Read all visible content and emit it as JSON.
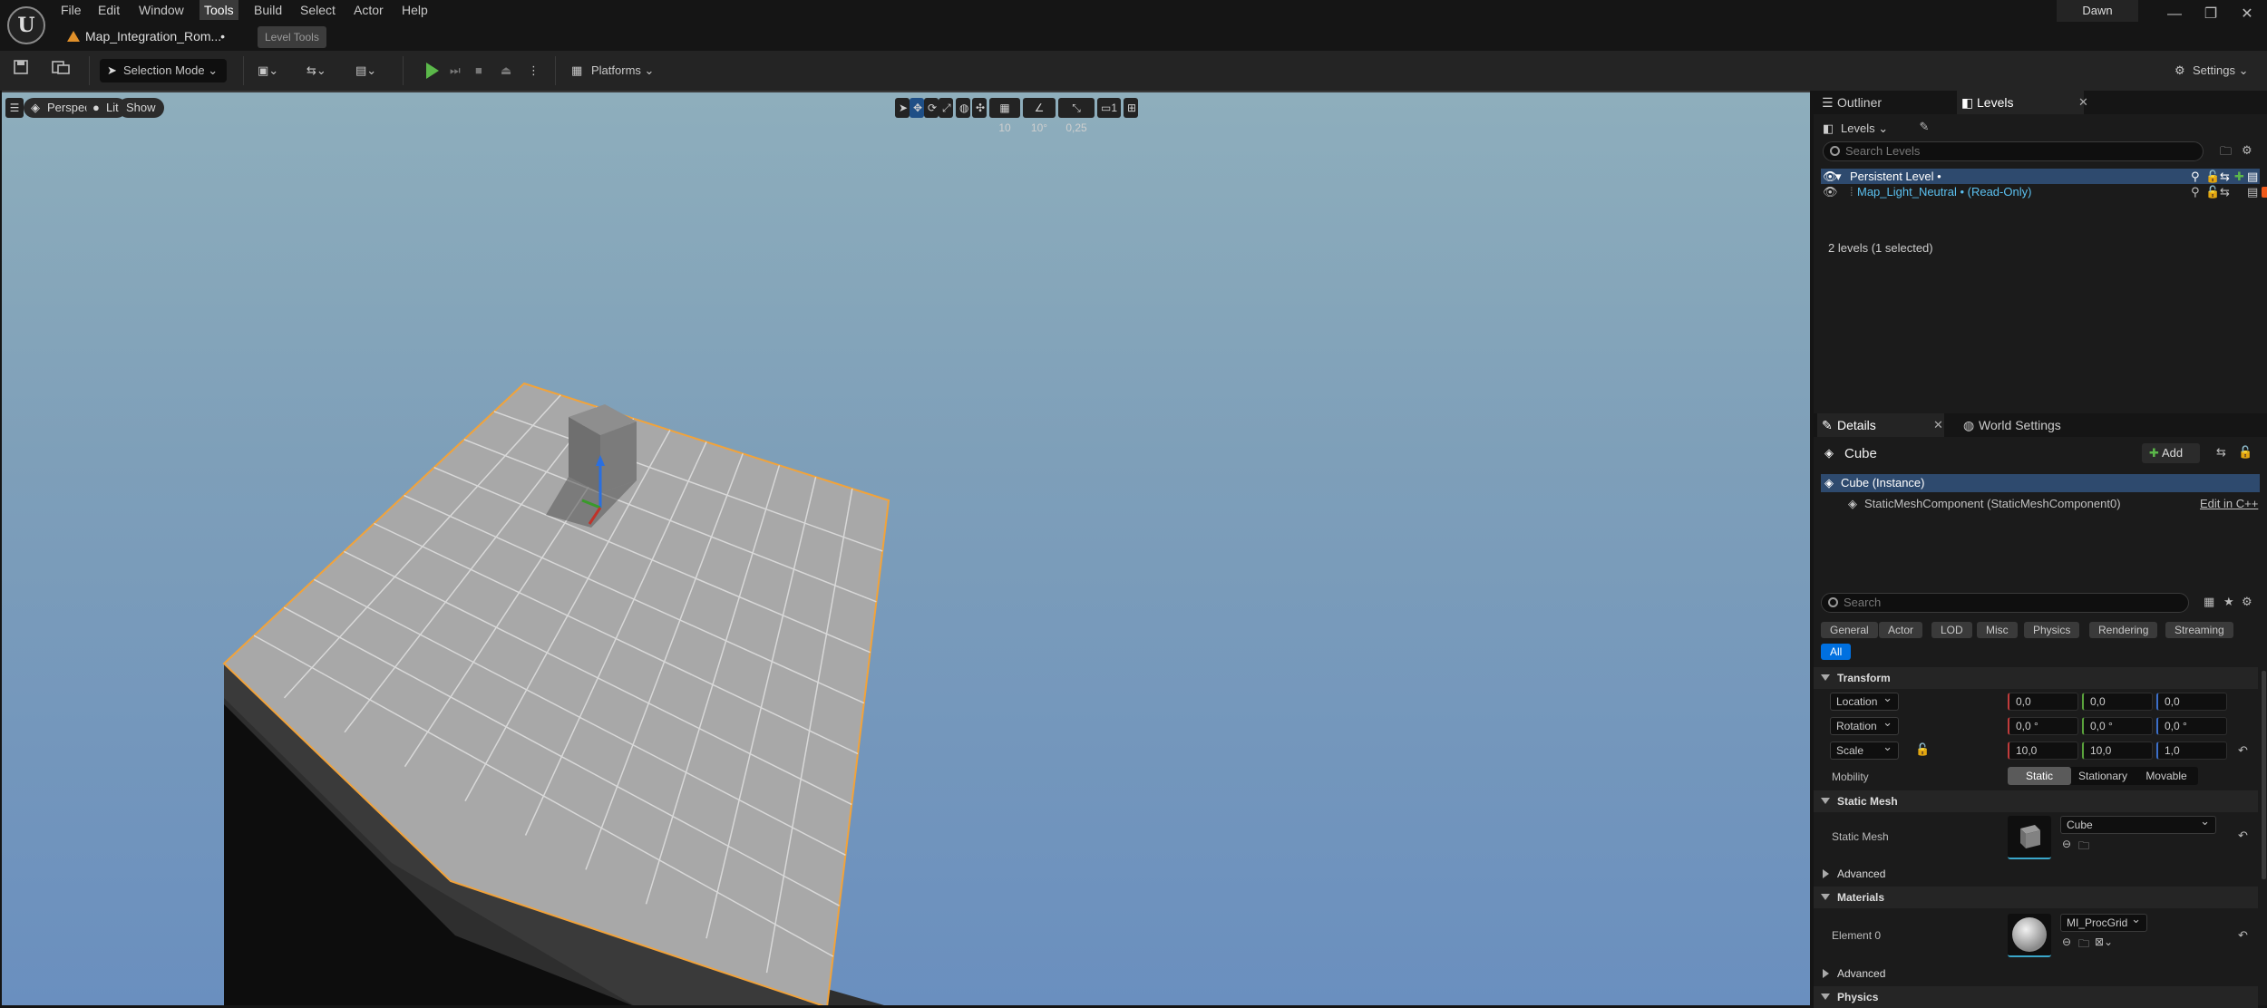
{
  "menu": [
    "File",
    "Edit",
    "Window",
    "Tools",
    "Build",
    "Select",
    "Actor",
    "Help"
  ],
  "menu_active": "Tools",
  "document_tab": {
    "title": "Map_Integration_Rom...",
    "modified_marker": "•"
  },
  "level_tools_label": "Level Tools",
  "user_name": "Dawn",
  "window_controls": {
    "minimize": "—",
    "maximize": "❐",
    "close": "✕"
  },
  "toolbar": {
    "selection_mode": "Selection Mode",
    "platforms": "Platforms",
    "settings": "Settings"
  },
  "viewport": {
    "perspective": "Perspective",
    "lit": "Lit",
    "show": "Show",
    "grid_snap": "10",
    "rotation_snap": "10°",
    "scale_snap": "0,25",
    "camera_speed": "1"
  },
  "outliner_panel": {
    "tabs": [
      "Outliner",
      "Levels"
    ],
    "levels_dropdown": "Levels",
    "search_placeholder": "Search Levels",
    "rows": [
      {
        "name": "Persistent Level •",
        "selected": true
      },
      {
        "name": "Map_Light_Neutral • (Read-Only)",
        "selected": false
      }
    ],
    "status": "2 levels (1 selected)"
  },
  "details_panel": {
    "tabs": [
      "Details",
      "World Settings"
    ],
    "actor_name": "Cube",
    "add_label": "Add",
    "components": [
      {
        "name": "Cube (Instance)",
        "selected": true
      },
      {
        "name": "StaticMeshComponent (StaticMeshComponent0)",
        "selected": false
      }
    ],
    "edit_cpp": "Edit in C++",
    "search_placeholder": "Search",
    "category_tabs": [
      "General",
      "Actor",
      "LOD",
      "Misc",
      "Physics",
      "Rendering",
      "Streaming"
    ],
    "all_tab": "All",
    "transform": {
      "header": "Transform",
      "location_label": "Location",
      "location": [
        "0,0",
        "0,0",
        "0,0"
      ],
      "rotation_label": "Rotation",
      "rotation": [
        "0,0 °",
        "0,0 °",
        "0,0 °"
      ],
      "scale_label": "Scale",
      "scale": [
        "10,0",
        "10,0",
        "1,0"
      ],
      "mobility_label": "Mobility",
      "mobility_options": [
        "Static",
        "Stationary",
        "Movable"
      ],
      "mobility_selected": "Static"
    },
    "static_mesh": {
      "header": "Static Mesh",
      "label": "Static Mesh",
      "value": "Cube"
    },
    "advanced_1": "Advanced",
    "materials": {
      "header": "Materials",
      "element_label": "Element 0",
      "value": "MI_ProcGrid"
    },
    "advanced_2": "Advanced",
    "physics_header": "Physics"
  },
  "colors": {
    "accent_blue": "#0070e0",
    "selection_orange": "#f2a33a",
    "play_green": "#5bb84a",
    "selected_row": "#2e4a6e"
  }
}
